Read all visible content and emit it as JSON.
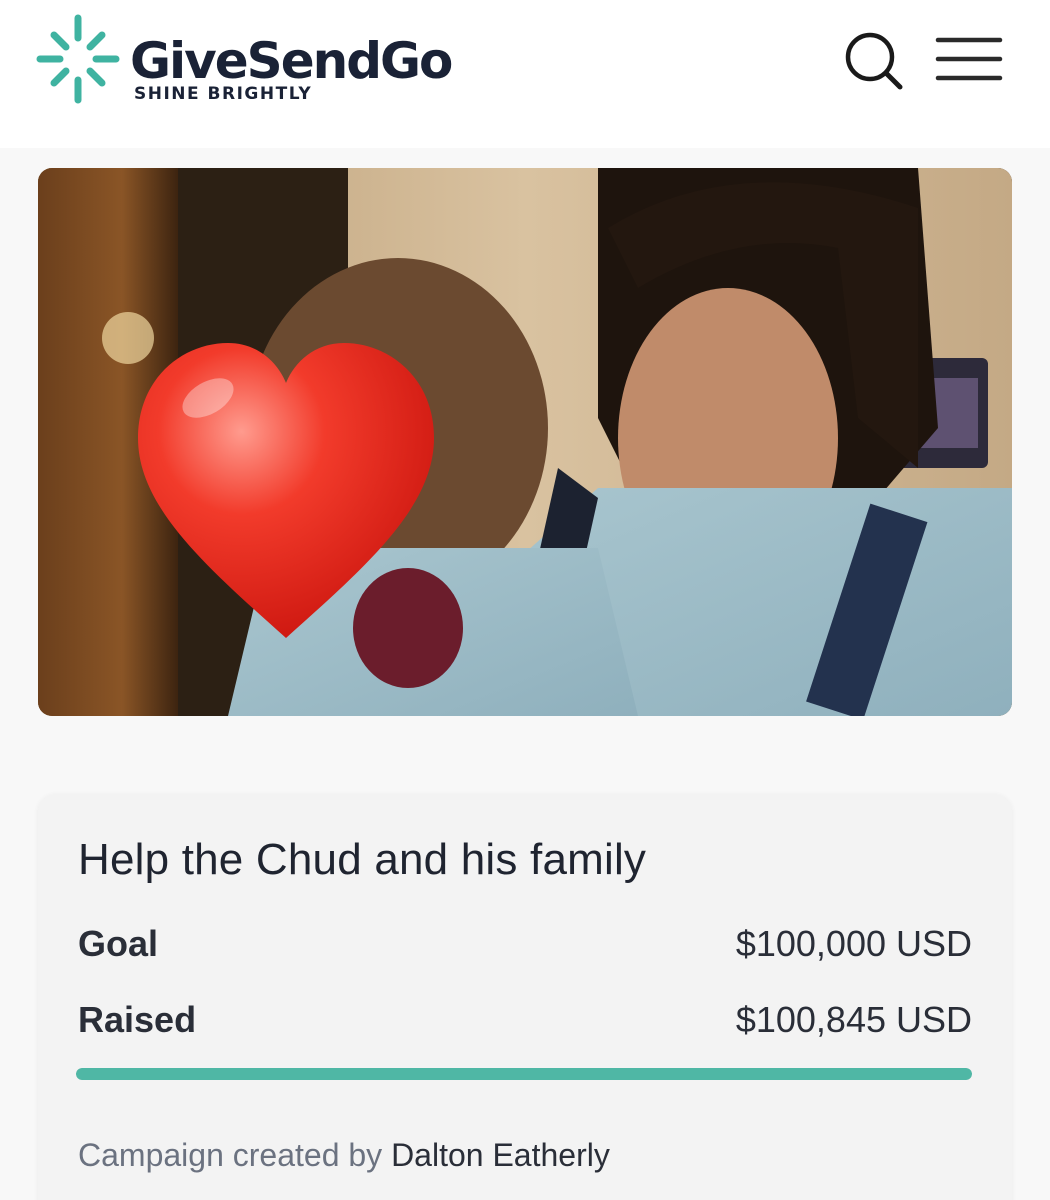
{
  "header": {
    "brand_name": "GiveSendGo",
    "tagline": "SHINE BRIGHTLY",
    "logo_icon": "sparkle-asterisk-logo",
    "search_icon": "search-icon",
    "menu_icon": "hamburger-menu-icon"
  },
  "colors": {
    "brand_teal": "#3fb3a1",
    "brand_navy": "#1a2236",
    "progress": "#4fb7a5"
  },
  "hero": {
    "image": "campaign-photo"
  },
  "campaign": {
    "title": "Help the Chud and his family",
    "goal_label": "Goal",
    "goal_value": "$100,000 USD",
    "raised_label": "Raised",
    "raised_value": "$100,845 USD",
    "progress_percent": 100,
    "created_by_label": "Campaign created by",
    "creator_name": "Dalton Eatherly"
  }
}
